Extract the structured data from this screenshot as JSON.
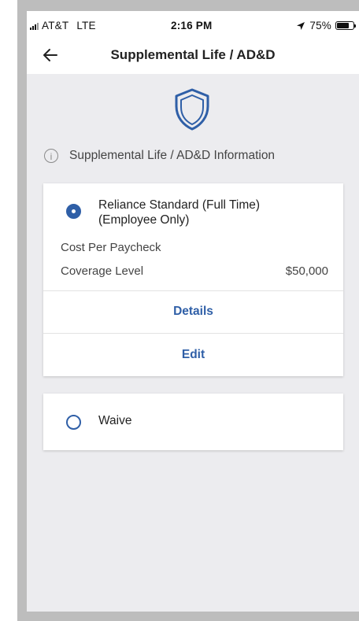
{
  "status_bar": {
    "carrier": "AT&T",
    "network": "LTE",
    "time": "2:16 PM",
    "battery_percent": "75%",
    "battery_level": 0.75
  },
  "header": {
    "title": "Supplemental Life / AD&D",
    "back_icon": "arrow-left-icon"
  },
  "info": {
    "label": "Supplemental Life / AD&D Information",
    "icon": "info-icon"
  },
  "plans": [
    {
      "name_line1": "Reliance Standard (Full Time)",
      "name_line2": "(Employee Only)",
      "selected": true,
      "cost_label": "Cost Per Paycheck",
      "cost_value": "",
      "coverage_label": "Coverage Level",
      "coverage_value": "$50,000",
      "details_label": "Details",
      "edit_label": "Edit"
    }
  ],
  "waive": {
    "label": "Waive",
    "selected": false
  },
  "colors": {
    "accent": "#2f5fa7",
    "background": "#ececef"
  }
}
